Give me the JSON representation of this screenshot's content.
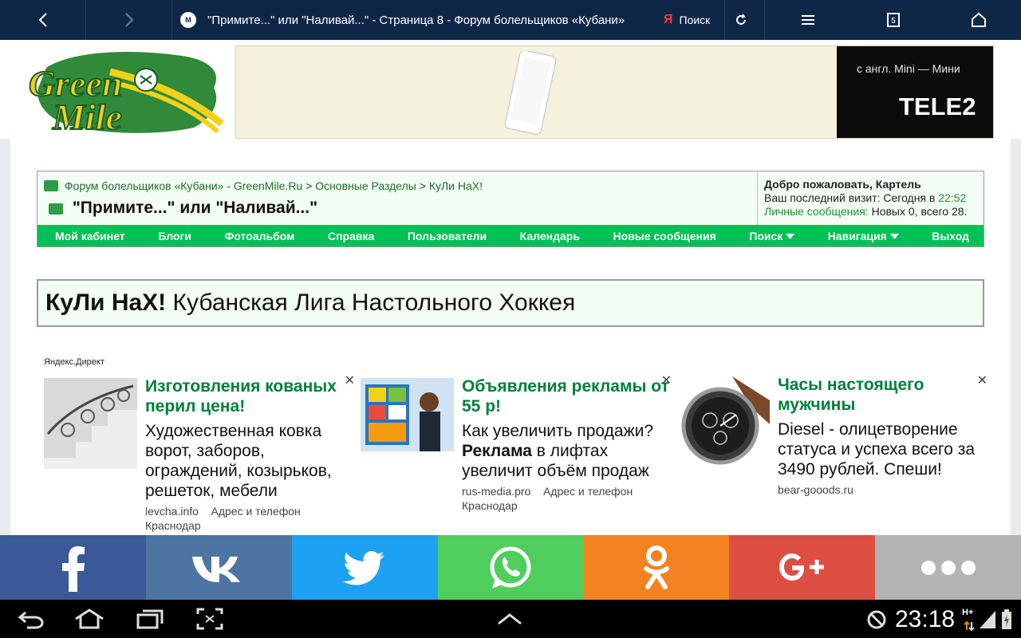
{
  "browser": {
    "tab_title": "\"Примите...\" или \"Наливай...\" - Страница 8 - Форум болельщиков «Кубани»",
    "yandex_label": "Я",
    "search_label": "Поиск",
    "tabs_count": "5",
    "site_badge": "M"
  },
  "banner": {
    "slogan": "с англ. Mini — Мини",
    "brand": "TELE2"
  },
  "breadcrumb": {
    "forum": "Форум болельщиков «Кубани» - GreenMile.Ru",
    "section": "Основные Разделы",
    "subsection": "КуЛи НаХ!",
    "separator": ">"
  },
  "thread_title": "\"Примите...\" или \"Наливай...\"",
  "welcome": {
    "greeting": "Добро пожаловать, Картель",
    "last_visit_label": "Ваш последний визит: Сегодня в",
    "last_visit_time": "22:52",
    "pm_link": "Личные сообщения:",
    "pm_stats": "Новых 0, всего 28."
  },
  "menu": [
    "Мой кабинет",
    "Блоги",
    "Фотоальбом",
    "Справка",
    "Пользователи",
    "Календарь",
    "Новые сообщения",
    "Поиск",
    "Навигация",
    "Выход"
  ],
  "forum": {
    "name": "КуЛи НаХ!",
    "desc": "Кубанская Лига Настольного Хоккея"
  },
  "ads_label": "Яндекс.Директ",
  "ads": [
    {
      "headline": "Изготовления кованых перил цена!",
      "body": "Художественная ковка ворот, заборов, ограждений, козырьков, решеток, мебели",
      "domain": "levcha.info",
      "contact": "Адрес и телефон",
      "city": "Краснодар"
    },
    {
      "headline": "Объявления рекламы от 55 р!",
      "body_prefix": "Как увеличить продажи?",
      "body_bold": "Реклама",
      "body_suffix": "в лифтах увеличит объём продаж",
      "domain": "rus-media.pro",
      "contact": "Адрес и телефон",
      "city": "Краснодар"
    },
    {
      "headline": "Часы настоящего мужчины",
      "body": "Diesel - олицетворение статуса и успеха всего за 3490 рублей. Спеши!",
      "domain": "bear-gooods.ru"
    }
  ],
  "share": [
    {
      "name": "facebook",
      "color": "#3b5998"
    },
    {
      "name": "vkontakte",
      "color": "#4c75a3"
    },
    {
      "name": "twitter",
      "color": "#1da1f2"
    },
    {
      "name": "whatsapp",
      "color": "#4fce5d"
    },
    {
      "name": "odnoklassniki",
      "color": "#f58220"
    },
    {
      "name": "google-plus",
      "color": "#dc4e41"
    },
    {
      "name": "more",
      "color": "#b3b3b3"
    }
  ],
  "status": {
    "time": "23:18",
    "network": "H+"
  }
}
